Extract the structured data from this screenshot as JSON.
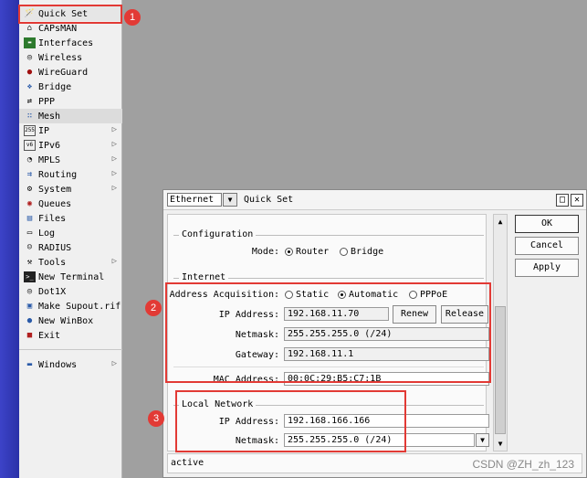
{
  "menu": {
    "items": [
      {
        "label": "Quick Set",
        "icon": "wand-icon"
      },
      {
        "label": "CAPsMAN",
        "icon": "capsman-icon"
      },
      {
        "label": "Interfaces",
        "icon": "interfaces-icon"
      },
      {
        "label": "Wireless",
        "icon": "wireless-icon"
      },
      {
        "label": "WireGuard",
        "icon": "wireguard-icon"
      },
      {
        "label": "Bridge",
        "icon": "bridge-icon"
      },
      {
        "label": "PPP",
        "icon": "ppp-icon"
      },
      {
        "label": "Mesh",
        "icon": "mesh-icon"
      },
      {
        "label": "IP",
        "icon": "ip-icon"
      },
      {
        "label": "IPv6",
        "icon": "ipv6-icon"
      },
      {
        "label": "MPLS",
        "icon": "mpls-icon"
      },
      {
        "label": "Routing",
        "icon": "routing-icon"
      },
      {
        "label": "System",
        "icon": "system-icon"
      },
      {
        "label": "Queues",
        "icon": "queues-icon"
      },
      {
        "label": "Files",
        "icon": "files-icon"
      },
      {
        "label": "Log",
        "icon": "log-icon"
      },
      {
        "label": "RADIUS",
        "icon": "radius-icon"
      },
      {
        "label": "Tools",
        "icon": "tools-icon"
      },
      {
        "label": "New Terminal",
        "icon": "terminal-icon"
      },
      {
        "label": "Dot1X",
        "icon": "dot1x-icon"
      },
      {
        "label": "Make Supout.rif",
        "icon": "supout-icon"
      },
      {
        "label": "New WinBox",
        "icon": "winbox-icon"
      },
      {
        "label": "Exit",
        "icon": "exit-icon"
      },
      {
        "label": "Windows",
        "icon": "windows-icon"
      }
    ]
  },
  "badges": [
    "1",
    "2",
    "3"
  ],
  "dialog": {
    "interface_select": "Ethernet",
    "title": "Quick Set",
    "configuration": {
      "section_title": "Configuration",
      "mode_label": "Mode:",
      "mode_router": "Router",
      "mode_bridge": "Bridge"
    },
    "internet": {
      "section_title": "Internet",
      "acq_label": "Address Acquisition:",
      "acq_static": "Static",
      "acq_automatic": "Automatic",
      "acq_pppoe": "PPPoE",
      "ip_label": "IP Address:",
      "ip_value": "192.168.11.70",
      "renew": "Renew",
      "release": "Release",
      "netmask_label": "Netmask:",
      "netmask_value": "255.255.255.0 (/24)",
      "gateway_label": "Gateway:",
      "gateway_value": "192.168.11.1",
      "mac_label": "MAC Address:",
      "mac_value": "00:0C:29:B5:C7:1B"
    },
    "local": {
      "section_title": "Local Network",
      "ip_label": "IP Address:",
      "ip_value": "192.168.166.166",
      "netmask_label": "Netmask:",
      "netmask_value": "255.255.255.0 (/24)"
    },
    "buttons": {
      "ok": "OK",
      "cancel": "Cancel",
      "apply": "Apply"
    },
    "status": "active"
  },
  "watermark": "CSDN @ZH_zh_123",
  "colors": {
    "annotation": "#e23a35",
    "strip": "#3c43c8"
  }
}
